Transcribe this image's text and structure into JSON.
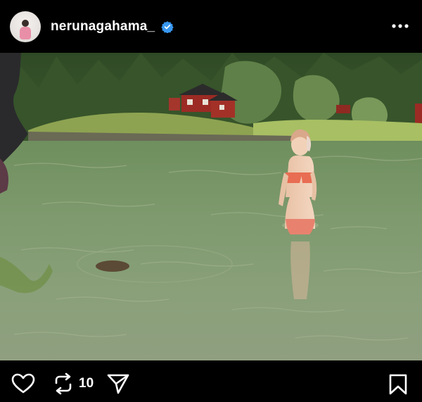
{
  "post": {
    "username": "nerunagahama_",
    "verified": true,
    "repost_count": "10"
  },
  "icons": {
    "verified": "verified-badge-icon",
    "more": "more-options-icon",
    "like": "heart-icon",
    "repost": "repost-icon",
    "share": "send-icon",
    "save": "bookmark-icon"
  },
  "colors": {
    "background": "#000000",
    "verified_badge": "#3897f0",
    "text": "#ffffff"
  }
}
